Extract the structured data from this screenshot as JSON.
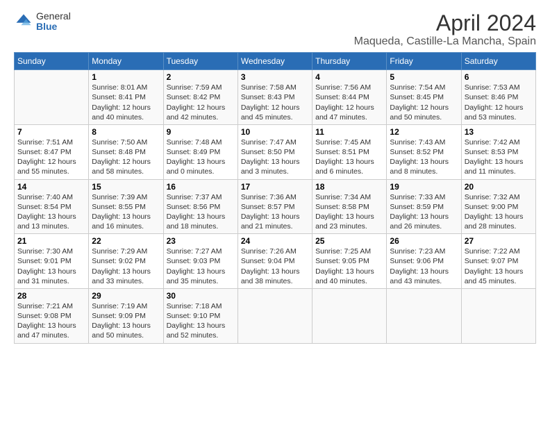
{
  "header": {
    "logo_general": "General",
    "logo_blue": "Blue",
    "title": "April 2024",
    "subtitle": "Maqueda, Castille-La Mancha, Spain"
  },
  "days_of_week": [
    "Sunday",
    "Monday",
    "Tuesday",
    "Wednesday",
    "Thursday",
    "Friday",
    "Saturday"
  ],
  "weeks": [
    [
      {
        "day": "",
        "sunrise": "",
        "sunset": "",
        "daylight": ""
      },
      {
        "day": "1",
        "sunrise": "Sunrise: 8:01 AM",
        "sunset": "Sunset: 8:41 PM",
        "daylight": "Daylight: 12 hours and 40 minutes."
      },
      {
        "day": "2",
        "sunrise": "Sunrise: 7:59 AM",
        "sunset": "Sunset: 8:42 PM",
        "daylight": "Daylight: 12 hours and 42 minutes."
      },
      {
        "day": "3",
        "sunrise": "Sunrise: 7:58 AM",
        "sunset": "Sunset: 8:43 PM",
        "daylight": "Daylight: 12 hours and 45 minutes."
      },
      {
        "day": "4",
        "sunrise": "Sunrise: 7:56 AM",
        "sunset": "Sunset: 8:44 PM",
        "daylight": "Daylight: 12 hours and 47 minutes."
      },
      {
        "day": "5",
        "sunrise": "Sunrise: 7:54 AM",
        "sunset": "Sunset: 8:45 PM",
        "daylight": "Daylight: 12 hours and 50 minutes."
      },
      {
        "day": "6",
        "sunrise": "Sunrise: 7:53 AM",
        "sunset": "Sunset: 8:46 PM",
        "daylight": "Daylight: 12 hours and 53 minutes."
      }
    ],
    [
      {
        "day": "7",
        "sunrise": "Sunrise: 7:51 AM",
        "sunset": "Sunset: 8:47 PM",
        "daylight": "Daylight: 12 hours and 55 minutes."
      },
      {
        "day": "8",
        "sunrise": "Sunrise: 7:50 AM",
        "sunset": "Sunset: 8:48 PM",
        "daylight": "Daylight: 12 hours and 58 minutes."
      },
      {
        "day": "9",
        "sunrise": "Sunrise: 7:48 AM",
        "sunset": "Sunset: 8:49 PM",
        "daylight": "Daylight: 13 hours and 0 minutes."
      },
      {
        "day": "10",
        "sunrise": "Sunrise: 7:47 AM",
        "sunset": "Sunset: 8:50 PM",
        "daylight": "Daylight: 13 hours and 3 minutes."
      },
      {
        "day": "11",
        "sunrise": "Sunrise: 7:45 AM",
        "sunset": "Sunset: 8:51 PM",
        "daylight": "Daylight: 13 hours and 6 minutes."
      },
      {
        "day": "12",
        "sunrise": "Sunrise: 7:43 AM",
        "sunset": "Sunset: 8:52 PM",
        "daylight": "Daylight: 13 hours and 8 minutes."
      },
      {
        "day": "13",
        "sunrise": "Sunrise: 7:42 AM",
        "sunset": "Sunset: 8:53 PM",
        "daylight": "Daylight: 13 hours and 11 minutes."
      }
    ],
    [
      {
        "day": "14",
        "sunrise": "Sunrise: 7:40 AM",
        "sunset": "Sunset: 8:54 PM",
        "daylight": "Daylight: 13 hours and 13 minutes."
      },
      {
        "day": "15",
        "sunrise": "Sunrise: 7:39 AM",
        "sunset": "Sunset: 8:55 PM",
        "daylight": "Daylight: 13 hours and 16 minutes."
      },
      {
        "day": "16",
        "sunrise": "Sunrise: 7:37 AM",
        "sunset": "Sunset: 8:56 PM",
        "daylight": "Daylight: 13 hours and 18 minutes."
      },
      {
        "day": "17",
        "sunrise": "Sunrise: 7:36 AM",
        "sunset": "Sunset: 8:57 PM",
        "daylight": "Daylight: 13 hours and 21 minutes."
      },
      {
        "day": "18",
        "sunrise": "Sunrise: 7:34 AM",
        "sunset": "Sunset: 8:58 PM",
        "daylight": "Daylight: 13 hours and 23 minutes."
      },
      {
        "day": "19",
        "sunrise": "Sunrise: 7:33 AM",
        "sunset": "Sunset: 8:59 PM",
        "daylight": "Daylight: 13 hours and 26 minutes."
      },
      {
        "day": "20",
        "sunrise": "Sunrise: 7:32 AM",
        "sunset": "Sunset: 9:00 PM",
        "daylight": "Daylight: 13 hours and 28 minutes."
      }
    ],
    [
      {
        "day": "21",
        "sunrise": "Sunrise: 7:30 AM",
        "sunset": "Sunset: 9:01 PM",
        "daylight": "Daylight: 13 hours and 31 minutes."
      },
      {
        "day": "22",
        "sunrise": "Sunrise: 7:29 AM",
        "sunset": "Sunset: 9:02 PM",
        "daylight": "Daylight: 13 hours and 33 minutes."
      },
      {
        "day": "23",
        "sunrise": "Sunrise: 7:27 AM",
        "sunset": "Sunset: 9:03 PM",
        "daylight": "Daylight: 13 hours and 35 minutes."
      },
      {
        "day": "24",
        "sunrise": "Sunrise: 7:26 AM",
        "sunset": "Sunset: 9:04 PM",
        "daylight": "Daylight: 13 hours and 38 minutes."
      },
      {
        "day": "25",
        "sunrise": "Sunrise: 7:25 AM",
        "sunset": "Sunset: 9:05 PM",
        "daylight": "Daylight: 13 hours and 40 minutes."
      },
      {
        "day": "26",
        "sunrise": "Sunrise: 7:23 AM",
        "sunset": "Sunset: 9:06 PM",
        "daylight": "Daylight: 13 hours and 43 minutes."
      },
      {
        "day": "27",
        "sunrise": "Sunrise: 7:22 AM",
        "sunset": "Sunset: 9:07 PM",
        "daylight": "Daylight: 13 hours and 45 minutes."
      }
    ],
    [
      {
        "day": "28",
        "sunrise": "Sunrise: 7:21 AM",
        "sunset": "Sunset: 9:08 PM",
        "daylight": "Daylight: 13 hours and 47 minutes."
      },
      {
        "day": "29",
        "sunrise": "Sunrise: 7:19 AM",
        "sunset": "Sunset: 9:09 PM",
        "daylight": "Daylight: 13 hours and 50 minutes."
      },
      {
        "day": "30",
        "sunrise": "Sunrise: 7:18 AM",
        "sunset": "Sunset: 9:10 PM",
        "daylight": "Daylight: 13 hours and 52 minutes."
      },
      {
        "day": "",
        "sunrise": "",
        "sunset": "",
        "daylight": ""
      },
      {
        "day": "",
        "sunrise": "",
        "sunset": "",
        "daylight": ""
      },
      {
        "day": "",
        "sunrise": "",
        "sunset": "",
        "daylight": ""
      },
      {
        "day": "",
        "sunrise": "",
        "sunset": "",
        "daylight": ""
      }
    ]
  ]
}
